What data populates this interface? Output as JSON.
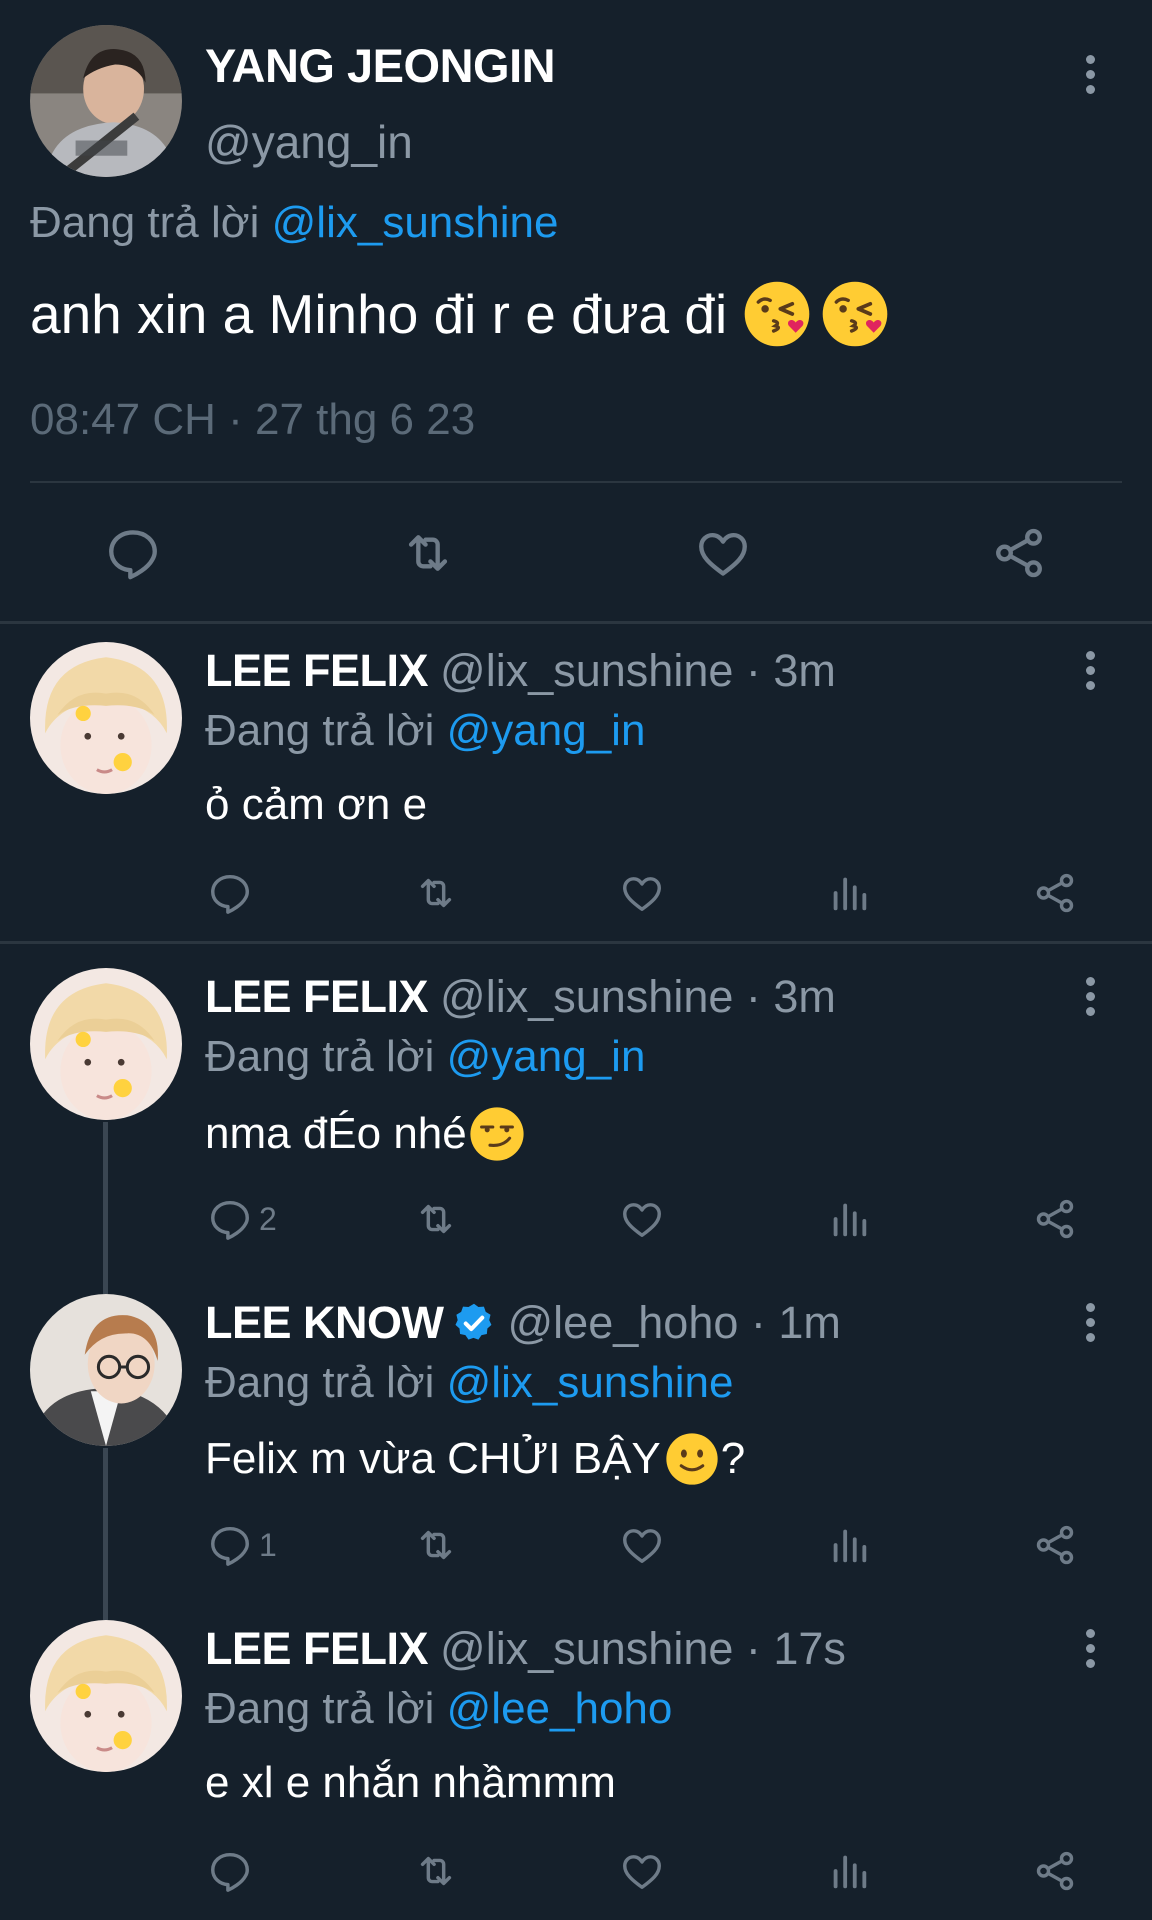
{
  "main_tweet": {
    "name": "YANG JEONGIN",
    "handle": "@yang_in",
    "replying_prefix": "Đang trả lời",
    "replying_to": "@lix_sunshine",
    "text": "anh xin a Minho đi r e đưa đi",
    "emojis": [
      "kissing-heart-emoji",
      "kissing-heart-emoji"
    ],
    "timestamp": "08:47 CH · 27 thg 6 23",
    "actions": [
      "reply",
      "retweet",
      "like",
      "share"
    ]
  },
  "replies": [
    {
      "name": "LEE FELIX",
      "meta": "@lix_sunshine · 3m",
      "replying_prefix": "Đang trả lời",
      "replying_to": "@yang_in",
      "text": "ỏ cảm ơn e",
      "reply_count": "",
      "verified": false
    },
    {
      "name": "LEE FELIX",
      "meta": "@lix_sunshine · 3m",
      "replying_prefix": "Đang trả lời",
      "replying_to": "@yang_in",
      "text": "nma đÉo nhé",
      "emoji": "smirking-face-emoji",
      "reply_count": "2",
      "verified": false
    },
    {
      "name": "LEE KNOW",
      "meta": "@lee_hoho · 1m",
      "replying_prefix": "Đang trả lời",
      "replying_to": "@lix_sunshine",
      "text_before": "Felix m vừa CHỬI BẬY",
      "text_after": "?",
      "emoji": "slightly-smiling-face-emoji",
      "reply_count": "1",
      "verified": true
    },
    {
      "name": "LEE FELIX",
      "meta": "@lix_sunshine · 17s",
      "replying_prefix": "Đang trả lời",
      "replying_to": "@lee_hoho",
      "text": "e xl e nhắn nhầmmm",
      "reply_count": "",
      "verified": false
    }
  ],
  "colors": {
    "background": "#15202b",
    "link": "#1d9bf0",
    "secondary_text": "#8b98a5",
    "icon": "#6e7b88",
    "verified": "#1d9bf0"
  }
}
